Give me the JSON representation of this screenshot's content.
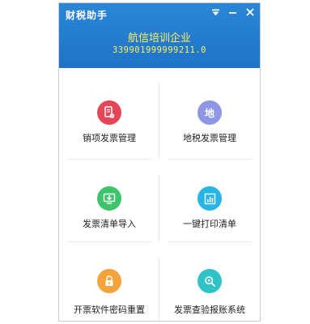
{
  "window": {
    "title": "财税助手",
    "controls": [
      "dropdown-icon",
      "minimize-icon",
      "close-icon"
    ]
  },
  "company": {
    "name": "航信培训企业",
    "tax_id": "339901999999211.0"
  },
  "tiles": [
    {
      "label": "销项发票管理",
      "icon": "invoice-icon",
      "color": "#e64557"
    },
    {
      "label": "地税发票管理",
      "icon": "local-tax-icon",
      "icon_text": "地",
      "color": "#8e97e4"
    },
    {
      "label": "发票清单导入",
      "icon": "import-icon",
      "color": "#3ec46a"
    },
    {
      "label": "一键打印清单",
      "icon": "print-list-icon",
      "color": "#27b5e6"
    },
    {
      "label": "开票软件密码重置",
      "icon": "lock-icon",
      "color": "#f4a43b"
    },
    {
      "label": "发票查验报账系统",
      "icon": "search-icon",
      "color": "#2fc3c8"
    }
  ],
  "colors": {
    "header_bg": "#2279cc",
    "company_text": "#ffef5a"
  }
}
